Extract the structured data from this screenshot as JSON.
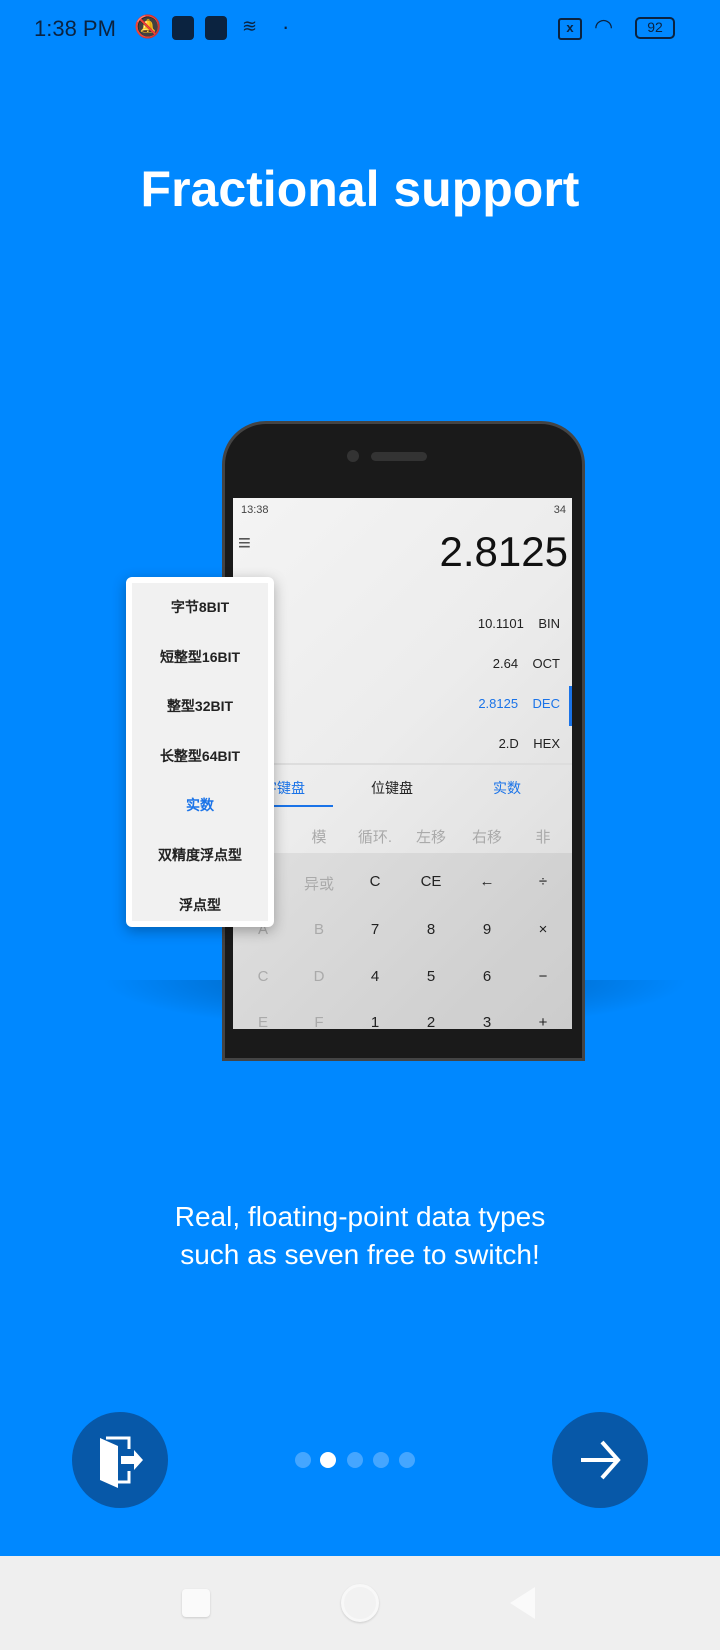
{
  "status_bar": {
    "time": "1:38 PM",
    "battery": "92",
    "icons": [
      "mute-vibrate-icon",
      "app-icon",
      "app-icon",
      "layers-icon",
      "dot-icon",
      "no-sim-icon",
      "wifi-icon",
      "battery-icon"
    ]
  },
  "title": "Fractional support",
  "mockup": {
    "status_time": "13:38",
    "status_battery": "34",
    "display": "2.8125",
    "bases": [
      {
        "value": "10.1101",
        "label": "BIN"
      },
      {
        "value": "2.64",
        "label": "OCT"
      },
      {
        "value": "2.8125",
        "label": "DEC"
      },
      {
        "value": "2.D",
        "label": "HEX"
      }
    ],
    "tabs": [
      "字键盘",
      "位键盘",
      "实数"
    ],
    "func_row": [
      "模",
      "循环.",
      "左移",
      "右移",
      "非"
    ],
    "keys": [
      [
        "异或",
        "C",
        "CE",
        "←",
        "÷"
      ],
      [
        "A",
        "B",
        "7",
        "8",
        "9",
        "×"
      ],
      [
        "C",
        "D",
        "4",
        "5",
        "6",
        "−"
      ],
      [
        "E",
        "F",
        "1",
        "2",
        "3",
        "+"
      ]
    ],
    "menu": [
      "字节8BIT",
      "短整型16BIT",
      "整型32BIT",
      "长整型64BIT",
      "实数",
      "双精度浮点型",
      "浮点型"
    ],
    "menu_selected": "实数"
  },
  "description": [
    "Real, floating-point data types",
    "such as seven free to switch!"
  ],
  "pager": {
    "pages": 5,
    "current": 2
  },
  "buttons": {
    "skip": "exit-door-icon",
    "next": "arrow-right-icon"
  },
  "colors": {
    "background": "#0088ff",
    "button": "#0758a8",
    "accent": "#1a73e8"
  }
}
